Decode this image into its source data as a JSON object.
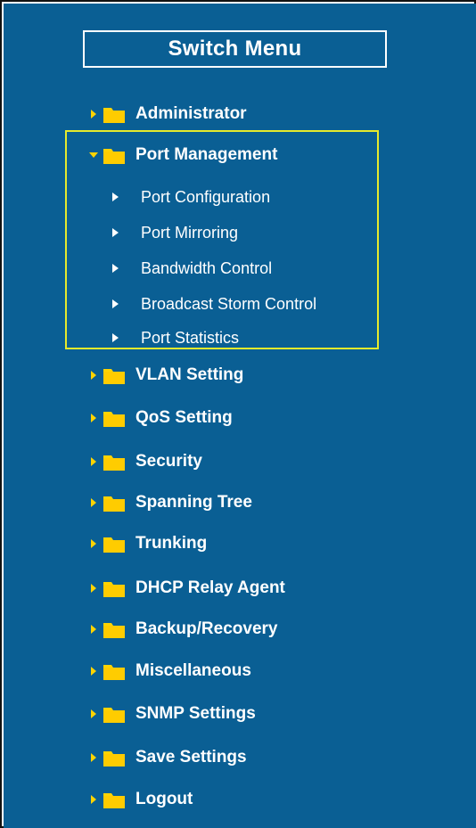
{
  "menu": {
    "title": "Switch Menu",
    "items": [
      {
        "label": "Administrator",
        "expanded": false
      },
      {
        "label": "Port Management",
        "expanded": true
      },
      {
        "label": "VLAN Setting",
        "expanded": false
      },
      {
        "label": "QoS Setting",
        "expanded": false
      },
      {
        "label": "Security",
        "expanded": false
      },
      {
        "label": "Spanning Tree",
        "expanded": false
      },
      {
        "label": "Trunking",
        "expanded": false
      },
      {
        "label": "DHCP Relay Agent",
        "expanded": false
      },
      {
        "label": "Backup/Recovery",
        "expanded": false
      },
      {
        "label": "Miscellaneous",
        "expanded": false
      },
      {
        "label": "SNMP Settings",
        "expanded": false
      },
      {
        "label": "Save Settings",
        "expanded": false
      },
      {
        "label": "Logout",
        "expanded": false
      }
    ],
    "port_management_submenu": [
      {
        "label": "Port Configuration"
      },
      {
        "label": "Port Mirroring"
      },
      {
        "label": "Bandwidth Control"
      },
      {
        "label": "Broadcast Storm Control"
      },
      {
        "label": "Port Statistics"
      }
    ]
  },
  "colors": {
    "background": "#0a5f94",
    "text": "#ffffff",
    "folder": "#ffd400",
    "caret": "#ffd400",
    "highlight_border": "#e6ea2c"
  },
  "icons": {
    "folder": "folder-icon",
    "collapsed": "caret-right-icon",
    "expanded": "caret-down-icon",
    "sub_bullet": "triangle-right-icon"
  }
}
